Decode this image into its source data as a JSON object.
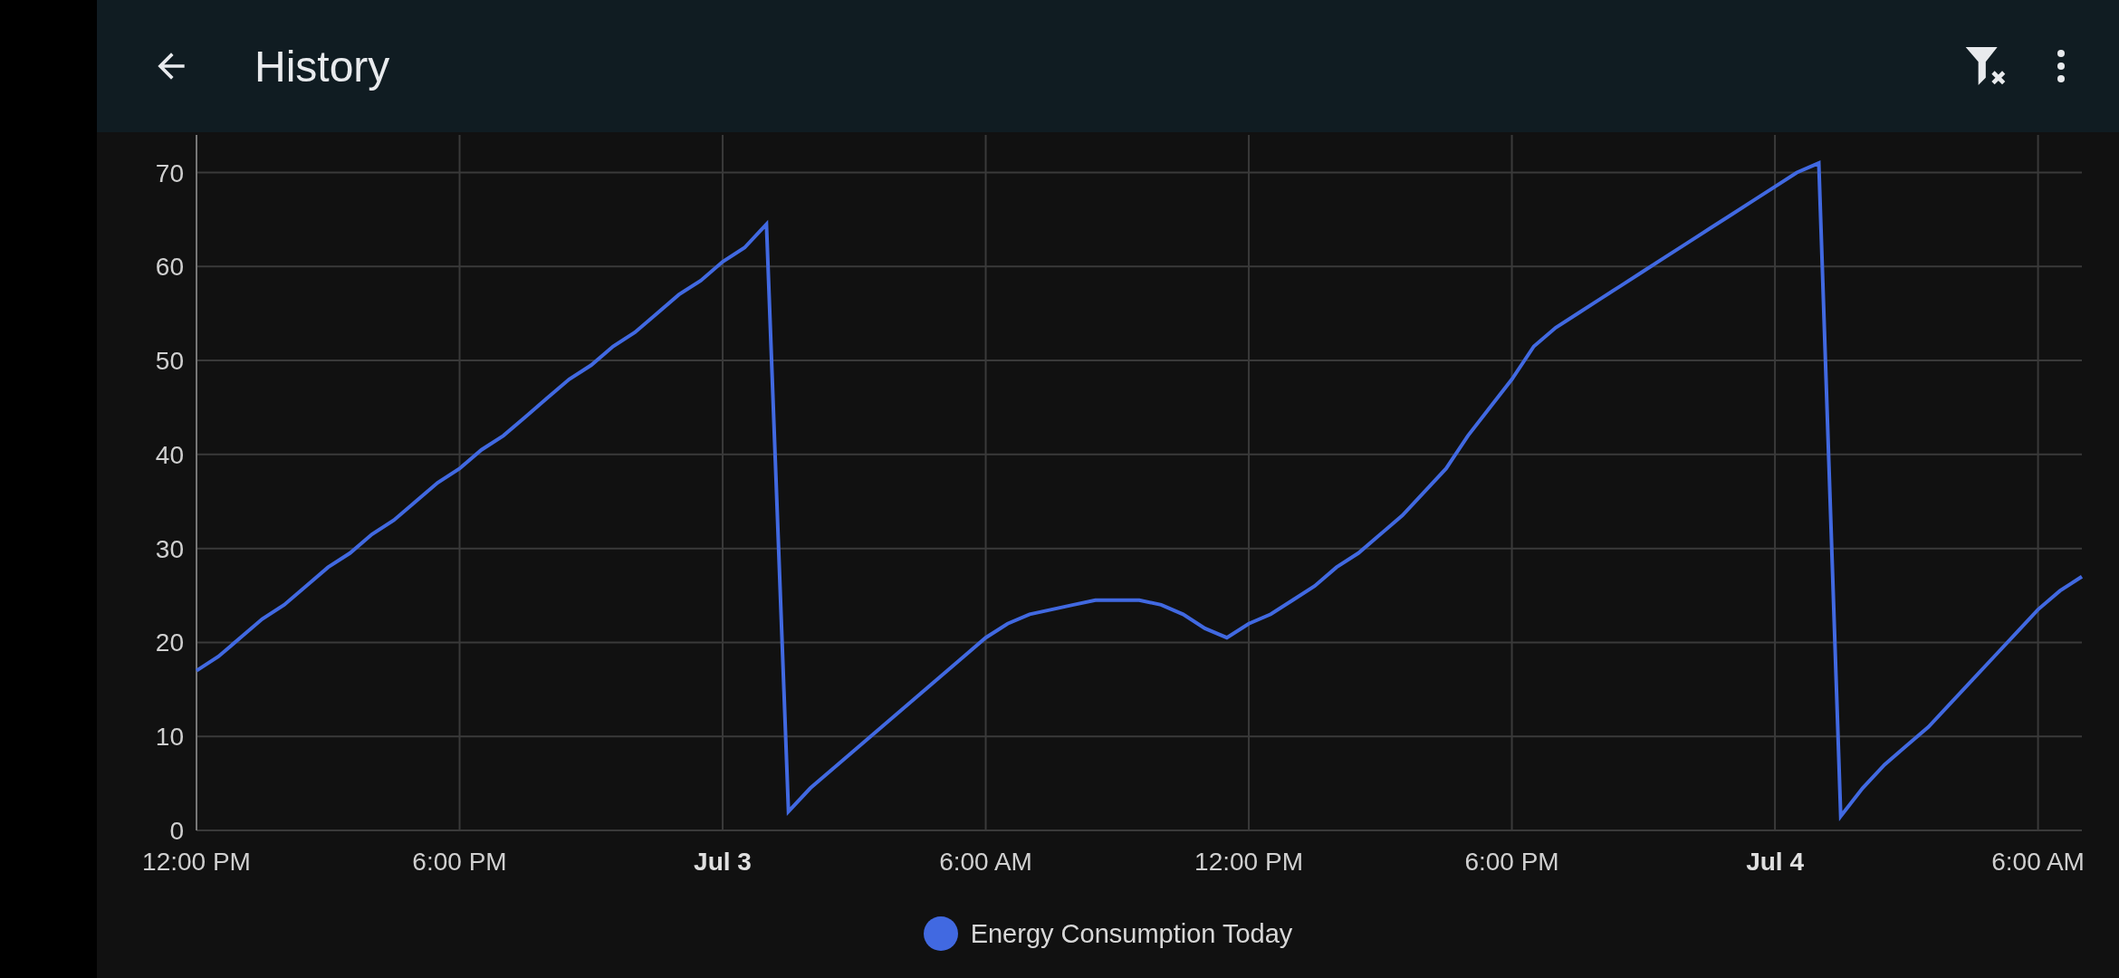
{
  "header": {
    "title": "History"
  },
  "chart": {
    "chart_data": {
      "type": "line",
      "grid": true,
      "categories": [
        "12:00 PM",
        null,
        null,
        null,
        null,
        null,
        null,
        null,
        null,
        null,
        null,
        null,
        "6:00 PM",
        null,
        null,
        null,
        null,
        null,
        null,
        null,
        null,
        null,
        null,
        null,
        "Jul 3",
        null,
        null,
        null,
        null,
        null,
        null,
        null,
        null,
        null,
        null,
        null,
        "6:00 AM",
        null,
        null,
        null,
        null,
        null,
        null,
        null,
        null,
        null,
        null,
        null,
        "12:00 PM",
        null,
        null,
        null,
        null,
        null,
        null,
        null,
        null,
        null,
        null,
        null,
        "6:00 PM",
        null,
        null,
        null,
        null,
        null,
        null,
        null,
        null,
        null,
        null,
        null,
        "Jul 4",
        null,
        null,
        null,
        null,
        null,
        null,
        null,
        null,
        null,
        null,
        null,
        "6:00 AM",
        null,
        null
      ],
      "series": [
        {
          "name": "Energy Consumption Today",
          "color": "#4169e1",
          "values": [
            17,
            18.5,
            20.5,
            22.5,
            24,
            26,
            28,
            29.5,
            31.5,
            33,
            35,
            37,
            38.5,
            40.5,
            42,
            44,
            46,
            48,
            49.5,
            51.5,
            53,
            55,
            57,
            58.5,
            60.5,
            62,
            64.5,
            2,
            4.5,
            6.5,
            8.5,
            10.5,
            12.5,
            14.5,
            16.5,
            18.5,
            20.5,
            22,
            23,
            23.5,
            24,
            24.5,
            24.5,
            24.5,
            24,
            23,
            21.5,
            20.5,
            22,
            23,
            24.5,
            26,
            28,
            29.5,
            31.5,
            33.5,
            36,
            38.5,
            42,
            45,
            48,
            51.5,
            53.5,
            55,
            56.5,
            58,
            59.5,
            61,
            62.5,
            64,
            65.5,
            67,
            68.5,
            70,
            71,
            1.5,
            4.5,
            7,
            9,
            11,
            13.5,
            16,
            18.5,
            21,
            23.5,
            25.5,
            27
          ]
        }
      ],
      "ylim": [
        0,
        74
      ],
      "yticks": [
        0,
        10,
        20,
        30,
        40,
        50,
        60,
        70
      ]
    }
  }
}
